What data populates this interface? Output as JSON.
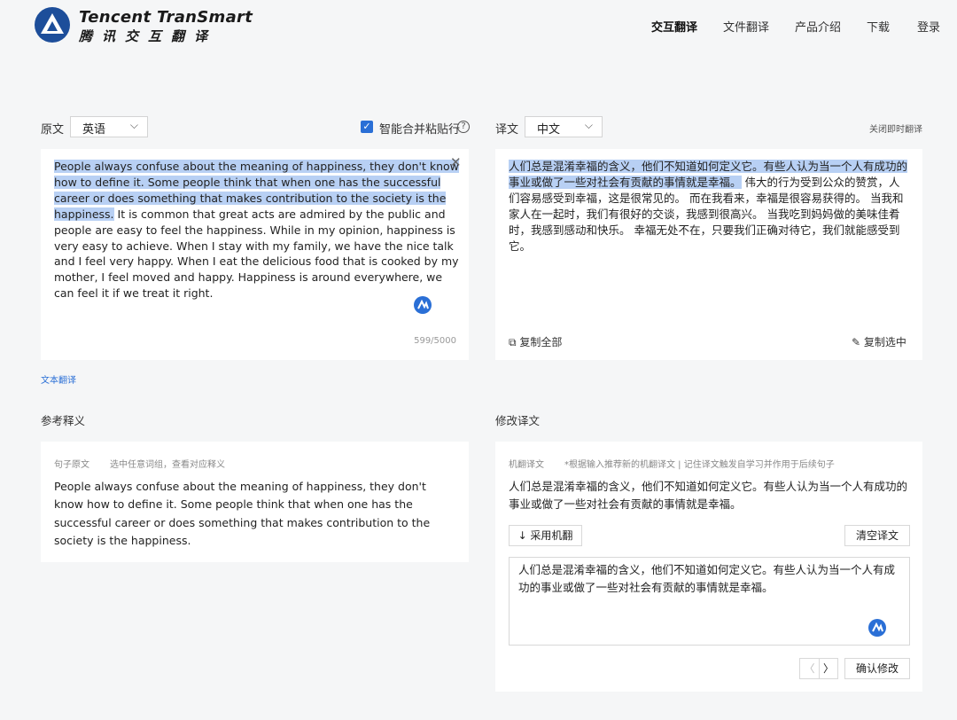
{
  "header": {
    "brand_en": "Tencent TranSmart",
    "brand_cn": "腾讯交互翻译",
    "nav": [
      "交互翻译",
      "文件翻译",
      "产品介绍",
      "下载",
      "登录"
    ]
  },
  "source": {
    "label": "原文",
    "language": "英语",
    "merge_label": "智能合并粘贴行",
    "merge_checked": true,
    "text_highlighted": "People always confuse about the meaning of happiness, they don't know how to define it. Some people think that when one has the successful career or does something that makes contribution to the society is the happiness.",
    "text_rest": " It is common that great acts are admired by the public and people are easy to feel the happiness. While in my opinion, happiness is very easy to achieve. When I stay with my family, we have the nice talk and I feel very happy. When I eat the delicious food that is cooked by my mother, I feel moved and happy. Happiness is around everywhere, we can feel it if we treat it right.",
    "char_count": "599/5000",
    "text_translate_link": "文本翻译"
  },
  "target": {
    "label": "译文",
    "language": "中文",
    "close_instant": "关闭即时翻译",
    "text_highlighted": "人们总是混淆幸福的含义，他们不知道如何定义它。有些人认为当一个人有成功的事业或做了一些对社会有贡献的事情就是幸福。",
    "text_rest": " 伟大的行为受到公众的赞赏，人们容易感受到幸福，这是很常见的。 而在我看来，幸福是很容易获得的。 当我和家人在一起时，我们有很好的交谈，我感到很高兴。 当我吃到妈妈做的美味佳肴时，我感到感动和快乐。 幸福无处不在，只要我们正确对待它，我们就能感受到它。",
    "copy_all": "复制全部",
    "copy_selected": "复制选中"
  },
  "reference": {
    "title": "参考释义",
    "sentence_label": "句子原文",
    "hint": "选中任意词组，查看对应释义",
    "sentence": "People always confuse about the meaning of happiness, they don't know how to define it. Some people think that when one has the successful career or does something that makes contribution to the society is the happiness."
  },
  "revise": {
    "title": "修改译文",
    "mt_label": "机翻译文",
    "mt_hint": "*根据输入推荐新的机翻译文 | 记住译文触发自学习并作用于后续句子",
    "mt_text": "人们总是混淆幸福的含义，他们不知道如何定义它。有些人认为当一个人有成功的事业或做了一些对社会有贡献的事情就是幸福。",
    "adopt_button": "↓ 采用机翻",
    "clear_button": "清空译文",
    "edit_text": "人们总是混淆幸福的含义，他们不知道如何定义它。有些人认为当一个人有成功的事业或做了一些对社会有贡献的事情就是幸福。",
    "prev": "〈",
    "next": "〉",
    "confirm_button": "确认修改"
  },
  "colors": {
    "accent": "#2a6fd6",
    "highlight": "#b8d0f4",
    "logo": "#1d4e9a"
  }
}
